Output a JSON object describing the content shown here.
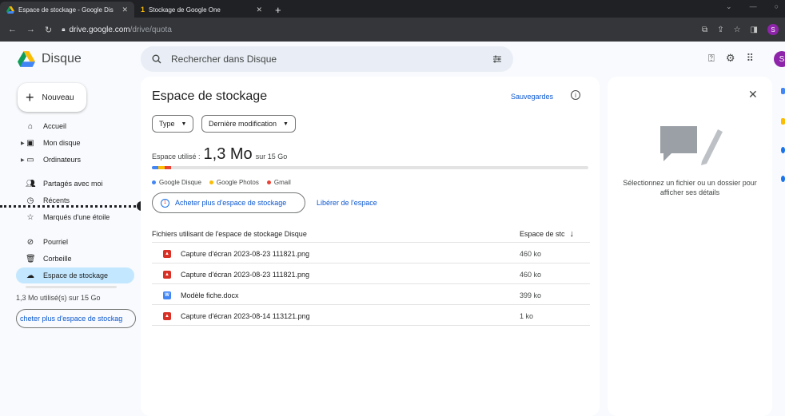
{
  "browser": {
    "tabs": [
      {
        "title": "Espace de stockage - Google Dis",
        "active": true
      },
      {
        "title": "Stockage de Google One",
        "active": false
      }
    ],
    "url_host": "drive.google.com",
    "url_path": "/drive/quota",
    "profile_initial": "S"
  },
  "header": {
    "logo_text": "Disque",
    "search_placeholder": "Rechercher dans Disque",
    "avatar_initial": "S"
  },
  "sidebar": {
    "new_label": "Nouveau",
    "items": [
      {
        "label": "Accueil",
        "icon": "home-icon"
      },
      {
        "label": "Mon disque",
        "icon": "drive-icon"
      },
      {
        "label": "Ordinateurs",
        "icon": "computer-icon"
      },
      {
        "label": "Partagés avec moi",
        "icon": "shared-icon"
      },
      {
        "label": "Récents",
        "icon": "clock-icon"
      },
      {
        "label": "Marqués d'une étoile",
        "icon": "star-icon"
      },
      {
        "label": "Pourriel",
        "icon": "spam-icon"
      },
      {
        "label": "Corbeille",
        "icon": "trash-icon"
      },
      {
        "label": "Espace de stockage",
        "icon": "cloud-icon",
        "active": true
      }
    ],
    "usage_text": "1,3 Mo utilisé(s) sur 15 Go",
    "usage_fraction": 0.0001,
    "buy_label": "cheter plus d'espace de stockag"
  },
  "main": {
    "title": "Espace de stockage",
    "backups_label": "Sauvegardes",
    "filter_type": "Type",
    "filter_modified": "Dernière modification",
    "used_prefix": "Espace utilisé :",
    "used_value": "1,3 Mo",
    "used_suffix": "sur 15 Go",
    "legend": [
      {
        "label": "Google Disque",
        "color": "#4285f4"
      },
      {
        "label": "Google Photos",
        "color": "#fbbc04"
      },
      {
        "label": "Gmail",
        "color": "#ea4335"
      }
    ],
    "buy_label": "Acheter plus d'espace de stockage",
    "free_label": "Libérer de l'espace",
    "table": {
      "col_name": "Fichiers utilisant de l'espace de stockage Disque",
      "col_size": "Espace de stc",
      "rows": [
        {
          "name": "Capture d'écran 2023-08-23 111821.png",
          "size": "460 ko",
          "type": "image"
        },
        {
          "name": "Capture d'écran 2023-08-23 111821.png",
          "size": "460 ko",
          "type": "image"
        },
        {
          "name": "Modèle fiche.docx",
          "size": "399 ko",
          "type": "doc"
        },
        {
          "name": "Capture d'écran 2023-08-14 113121.png",
          "size": "1 ko",
          "type": "image"
        }
      ]
    }
  },
  "details": {
    "message": "Sélectionnez un fichier ou un dossier pour afficher ses détails"
  },
  "colors": {
    "accent": "#0b57d0",
    "active_nav": "#c2e7ff"
  }
}
